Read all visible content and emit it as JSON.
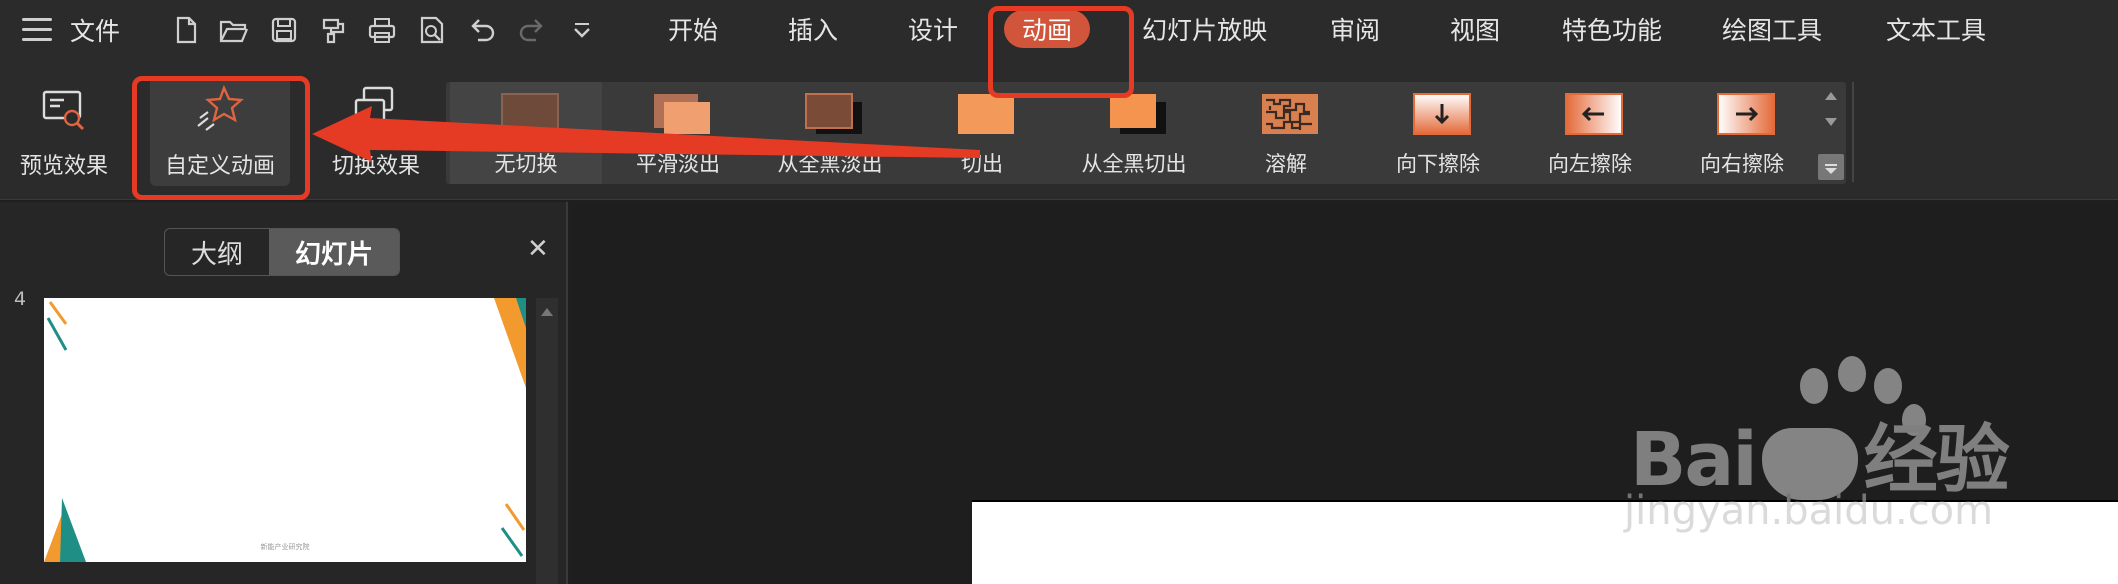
{
  "menubar": {
    "file_label": "文件",
    "quick_access": [
      "new-doc-icon",
      "open-folder-icon",
      "save-icon",
      "format-painter-icon",
      "print-icon",
      "print-preview-icon",
      "undo-icon",
      "redo-icon",
      "customize-dropdown-icon"
    ],
    "tabs": [
      "开始",
      "插入",
      "设计",
      "动画",
      "幻灯片放映",
      "审阅",
      "视图",
      "特色功能",
      "绘图工具",
      "文本工具"
    ],
    "active_tab": "动画"
  },
  "ribbon": {
    "preview_label": "预览效果",
    "custom_animation_label": "自定义动画",
    "transition_label": "切换效果",
    "gallery": [
      {
        "label": "无切换",
        "icon": "no-transition-icon"
      },
      {
        "label": "平滑淡出",
        "icon": "fade-smooth-icon"
      },
      {
        "label": "从全黑淡出",
        "icon": "fade-black-icon"
      },
      {
        "label": "切出",
        "icon": "cut-icon"
      },
      {
        "label": "从全黑切出",
        "icon": "cut-black-icon"
      },
      {
        "label": "溶解",
        "icon": "dissolve-icon"
      },
      {
        "label": "向下擦除",
        "icon": "wipe-down-icon"
      },
      {
        "label": "向左擦除",
        "icon": "wipe-left-icon"
      },
      {
        "label": "向右擦除",
        "icon": "wipe-right-icon"
      }
    ]
  },
  "left_panel": {
    "outline_tab": "大纲",
    "slides_tab": "幻灯片",
    "slide_number": "4",
    "slide_footer": "新能产业研究院"
  },
  "watermark": {
    "brand": "Bai",
    "brand_suffix": "经验",
    "url": "jingyan.baidu.com"
  },
  "colors": {
    "accent": "#d0553a",
    "annotation_red": "#e53a24",
    "teal": "#1f8f86",
    "orange": "#f29a2e"
  }
}
